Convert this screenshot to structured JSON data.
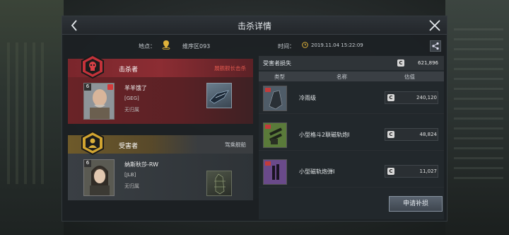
{
  "title": "击杀详情",
  "info": {
    "location_label": "地点：",
    "location_value": "维序区093",
    "time_label": "时间：",
    "time_value": "2019.11.04 15:22:09"
  },
  "killer": {
    "role": "击杀者",
    "tag": "展舰舰长击杀",
    "level": "6",
    "name": "羊羊饿了",
    "corp": "[GEG]",
    "alliance": "无归属"
  },
  "victim": {
    "role": "受害者",
    "tag": "驾乘舰船",
    "level": "6",
    "name": "纳斯秋莎-RW",
    "corp": "[JLB]",
    "alliance": "无归属"
  },
  "loss": {
    "title": "受害者损失",
    "total": "621,896",
    "columns": [
      "类型",
      "名称",
      "估值"
    ],
    "items": [
      {
        "name": "冷雨级",
        "value": "240,120",
        "color": "#4f5c68"
      },
      {
        "name": "小型格斗2联磁轨炮Ⅰ",
        "value": "48,824",
        "color": "#5a7a3a"
      },
      {
        "name": "小型磁轨炮弹Ⅰ",
        "value": "11,027",
        "color": "#6a4a8a"
      }
    ]
  },
  "claim_button": "申请补损",
  "isk_symbol": "C",
  "colors": {
    "killer_red": "#8c2d33",
    "victim_gold": "#c49a2c",
    "accent_red": "#e0584e"
  }
}
